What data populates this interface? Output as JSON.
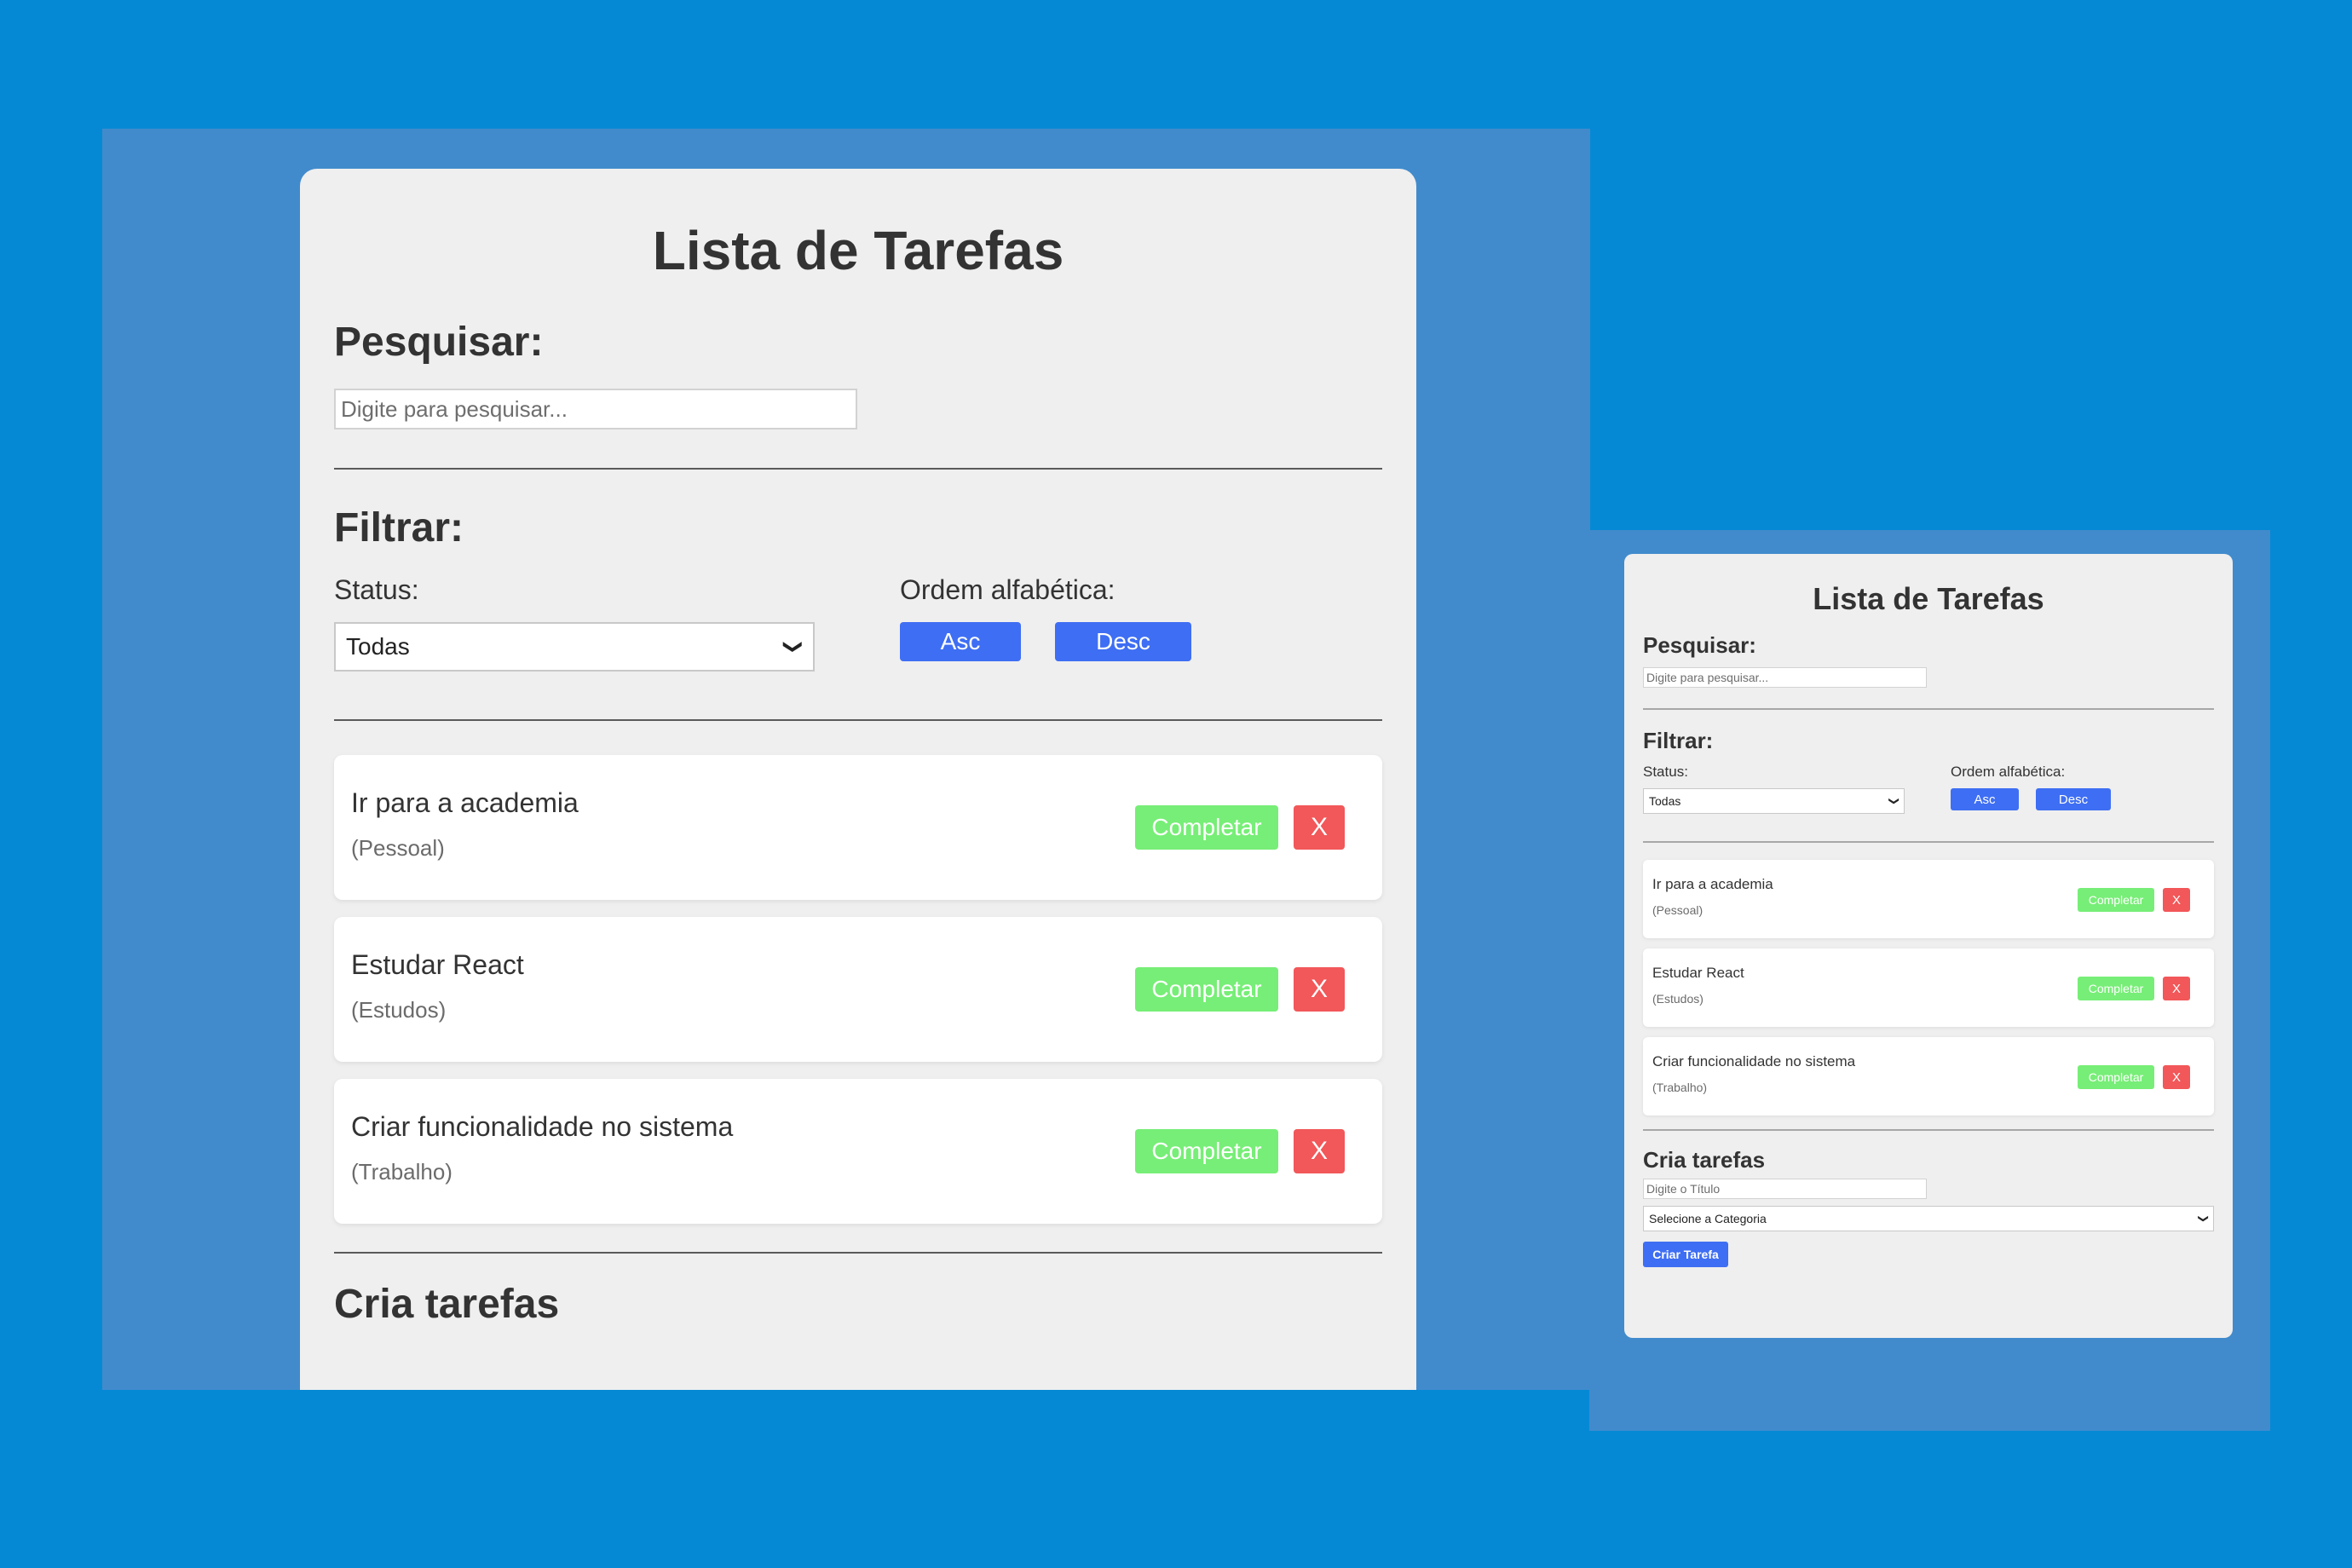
{
  "app": {
    "title": "Lista de Tarefas",
    "search": {
      "heading": "Pesquisar:",
      "placeholder": "Digite para pesquisar...",
      "value": ""
    },
    "filter": {
      "heading": "Filtrar:",
      "status_label": "Status:",
      "status_value": "Todas",
      "sort_label": "Ordem alfabética:",
      "asc_label": "Asc",
      "desc_label": "Desc"
    },
    "tasks": [
      {
        "title": "Ir para a academia",
        "category": "(Pessoal)"
      },
      {
        "title": "Estudar React",
        "category": "(Estudos)"
      },
      {
        "title": "Criar funcionalidade no sistema",
        "category": "(Trabalho)"
      }
    ],
    "task_actions": {
      "complete_label": "Completar",
      "delete_label": "X"
    },
    "create": {
      "heading": "Cria tarefas",
      "title_placeholder": "Digite o Título",
      "category_placeholder": "Selecione a Categoria",
      "button_label": "Criar Tarefa"
    }
  },
  "colors": {
    "page_background": "#0689d5",
    "panel_background": "#418bcc",
    "card_background": "#efefef",
    "primary_button": "#3e6ef3",
    "complete_button": "#77ee77",
    "delete_button": "#f25759"
  },
  "icons": {
    "select_arrow": "chevron-down-icon"
  }
}
